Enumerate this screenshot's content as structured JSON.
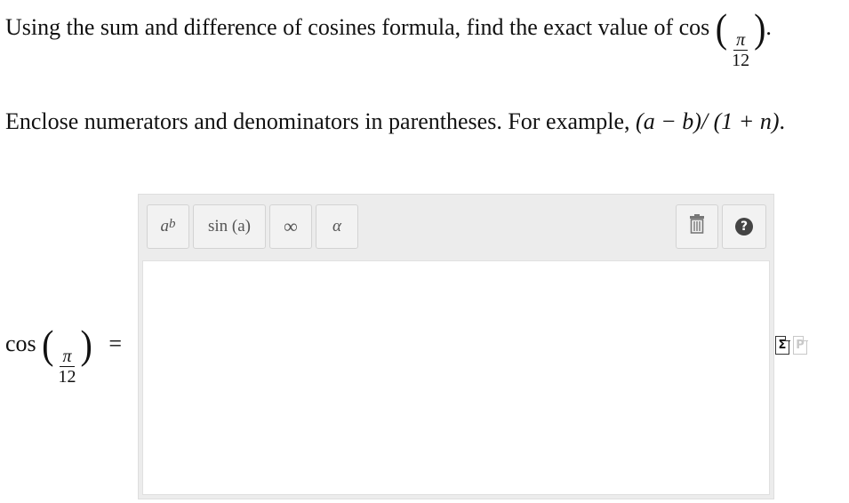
{
  "question": {
    "prefix": "Using the sum and difference of cosines formula, find the exact value of cos",
    "arg_numerator": "π",
    "arg_denominator": "12",
    "suffix": "."
  },
  "instruction": {
    "text": "Enclose numerators and denominators in parentheses. For example,",
    "example": "(a − b)/ (1 + n)",
    "end": "."
  },
  "answer_row": {
    "func": "cos",
    "arg_numerator": "π",
    "arg_denominator": "12",
    "equals": "="
  },
  "toolbar": {
    "power_base": "a",
    "power_exp": "b",
    "sin_label": "sin (a)",
    "infinity_label": "∞",
    "alpha_label": "α",
    "help_label": "?"
  },
  "side_icons": {
    "sigma_icon_glyph": "Σ",
    "plain_icon_glyph": "P"
  },
  "colors": {
    "toolbar_bg": "#ececec",
    "button_bg": "#f2f2f2",
    "answer_bg": "#ffffff"
  },
  "icons": [
    "trash-icon",
    "help-icon",
    "sigma-math-icon",
    "plain-text-icon"
  ]
}
